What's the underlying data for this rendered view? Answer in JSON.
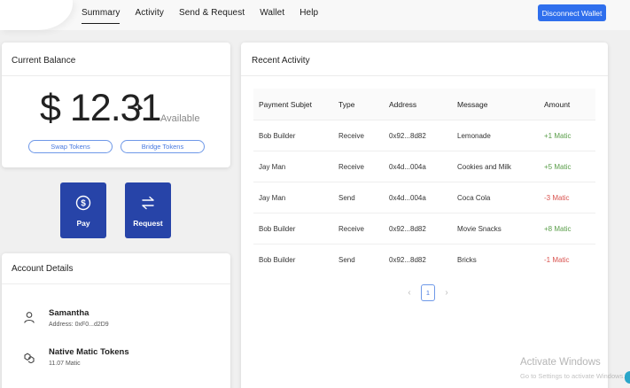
{
  "nav": {
    "items": [
      {
        "label": "Summary",
        "active": true
      },
      {
        "label": "Activity",
        "active": false
      },
      {
        "label": "Send & Request",
        "active": false
      },
      {
        "label": "Wallet",
        "active": false
      },
      {
        "label": "Help",
        "active": false
      }
    ],
    "disconnect_label": "Disconnect Wallet"
  },
  "balance": {
    "title": "Current Balance",
    "amount": "$ 12.31",
    "available_label": "Available",
    "swap_label": "Swap Tokens",
    "bridge_label": "Bridge Tokens"
  },
  "actions": {
    "pay_label": "Pay",
    "pay_icon": "dollar-circle-icon",
    "request_label": "Request",
    "request_icon": "swap-arrows-icon",
    "tile_color": "#2744a8"
  },
  "account": {
    "title": "Account Details",
    "name": "Samantha",
    "address": "Address: 0xF0...d2D9",
    "name_icon": "user-icon",
    "token_title": "Native Matic Tokens",
    "token_amount": "11.07 Matic",
    "token_icon": "matic-icon"
  },
  "activity": {
    "title": "Recent Activity",
    "columns": [
      "Payment Subjet",
      "Type",
      "Address",
      "Message",
      "Amount"
    ],
    "rows": [
      {
        "subject": "Bob Builder",
        "type": "Receive",
        "address": "0x92...8d82",
        "message": "Lemonade",
        "amount": "+1 Matic",
        "positive": true
      },
      {
        "subject": "Jay Man",
        "type": "Receive",
        "address": "0x4d...004a",
        "message": "Cookies and Milk",
        "amount": "+5 Matic",
        "positive": true
      },
      {
        "subject": "Jay Man",
        "type": "Send",
        "address": "0x4d...004a",
        "message": "Coca Cola",
        "amount": "-3 Matic",
        "positive": false
      },
      {
        "subject": "Bob Builder",
        "type": "Receive",
        "address": "0x92...8d82",
        "message": "Movie Snacks",
        "amount": "+8 Matic",
        "positive": true
      },
      {
        "subject": "Bob Builder",
        "type": "Send",
        "address": "0x92...8d82",
        "message": "Bricks",
        "amount": "-1 Matic",
        "positive": false
      }
    ],
    "page": "1"
  },
  "watermark": {
    "title": "Activate Windows",
    "subtitle": "Go to Settings to activate Windows."
  },
  "colors": {
    "accent": "#2f6fed",
    "positive": "#5a9e4a",
    "negative": "#d9534f"
  }
}
